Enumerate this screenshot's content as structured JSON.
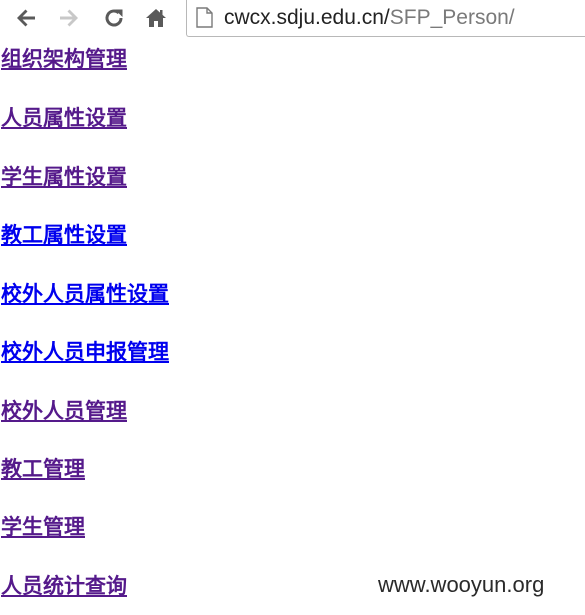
{
  "browser": {
    "url_host": "cwcx.sdju.edu.cn/",
    "url_path": "SFP_Person/",
    "icons": [
      "back-arrow-icon",
      "forward-arrow-icon",
      "reload-icon",
      "home-icon",
      "page-icon"
    ],
    "colors": {
      "icon_active": "#5a5a5a",
      "icon_disabled": "#c8c8c8"
    }
  },
  "links": [
    {
      "label": "组织架构管理",
      "state": "visited"
    },
    {
      "label": "人员属性设置",
      "state": "visited"
    },
    {
      "label": "学生属性设置",
      "state": "visited"
    },
    {
      "label": "教工属性设置",
      "state": "unvisited"
    },
    {
      "label": "校外人员属性设置",
      "state": "unvisited"
    },
    {
      "label": "校外人员申报管理",
      "state": "unvisited"
    },
    {
      "label": "校外人员管理",
      "state": "visited"
    },
    {
      "label": "教工管理",
      "state": "visited"
    },
    {
      "label": "学生管理",
      "state": "visited"
    },
    {
      "label": "人员统计查询",
      "state": "visited"
    }
  ],
  "colors": {
    "visited_link": "#551a8b",
    "unvisited_link": "#0000ee"
  },
  "watermark": "www.wooyun.org"
}
